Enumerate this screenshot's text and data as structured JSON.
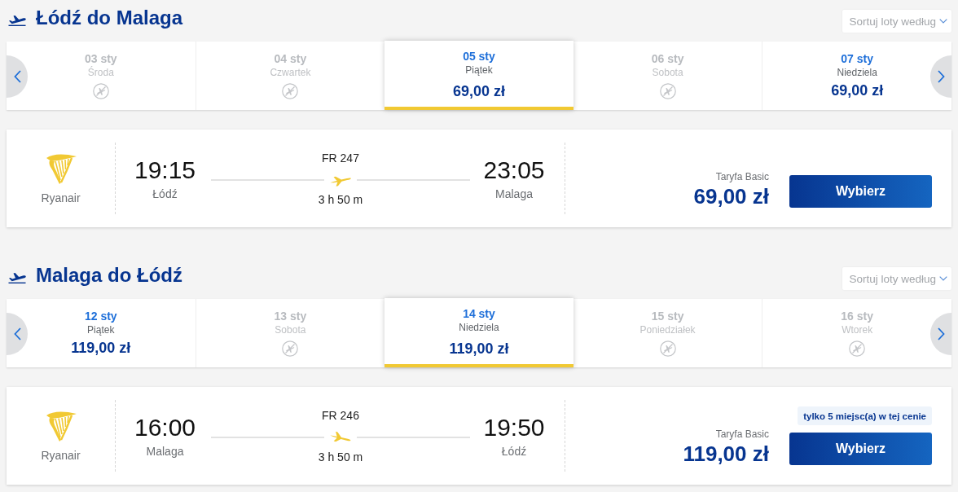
{
  "sections": [
    {
      "title": "Łódź do Malaga",
      "kind": "outbound",
      "sort_label": "Sortuj loty według",
      "dates": [
        {
          "date": "03 sty",
          "day": "Środa",
          "available": false,
          "selected": false
        },
        {
          "date": "04 sty",
          "day": "Czwartek",
          "available": false,
          "selected": false
        },
        {
          "date": "05 sty",
          "day": "Piątek",
          "available": true,
          "price": "69,00 zł",
          "selected": true
        },
        {
          "date": "06 sty",
          "day": "Sobota",
          "available": false,
          "selected": false
        },
        {
          "date": "07 sty",
          "day": "Niedziela",
          "available": true,
          "price": "69,00 zł",
          "selected": false
        }
      ],
      "flight": {
        "airline": "Ryanair",
        "departure": {
          "time": "19:15",
          "place": "Łódź"
        },
        "flight_number": "FR 247",
        "duration": "3 h 50 m",
        "arrival": {
          "time": "23:05",
          "place": "Malaga"
        },
        "fare": "Taryfa Basic",
        "price": "69,00 zł",
        "button": "Wybierz"
      }
    },
    {
      "title": "Malaga do Łódź",
      "kind": "return",
      "sort_label": "Sortuj loty według",
      "dates": [
        {
          "date": "12 sty",
          "day": "Piątek",
          "available": true,
          "price": "119,00 zł",
          "selected": false
        },
        {
          "date": "13 sty",
          "day": "Sobota",
          "available": false,
          "selected": false
        },
        {
          "date": "14 sty",
          "day": "Niedziela",
          "available": true,
          "price": "119,00 zł",
          "selected": true
        },
        {
          "date": "15 sty",
          "day": "Poniedziałek",
          "available": false,
          "selected": false
        },
        {
          "date": "16 sty",
          "day": "Wtorek",
          "available": false,
          "selected": false
        }
      ],
      "flight": {
        "airline": "Ryanair",
        "departure": {
          "time": "16:00",
          "place": "Malaga"
        },
        "flight_number": "FR 246",
        "duration": "3 h 50 m",
        "arrival": {
          "time": "19:50",
          "place": "Łódź"
        },
        "fare": "Taryfa Basic",
        "price": "119,00 zł",
        "badge": "tylko 5 miejsc(a) w tej cenie",
        "button": "Wybierz"
      }
    }
  ]
}
